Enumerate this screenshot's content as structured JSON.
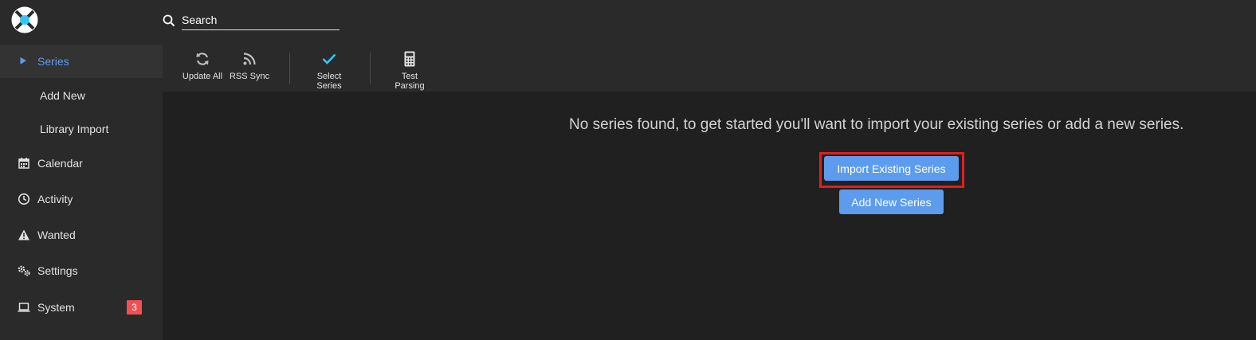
{
  "header": {
    "logo_icon": "sonarr-logo-icon",
    "search": {
      "placeholder": "Search",
      "value": ""
    }
  },
  "sidebar": {
    "items": [
      {
        "label": "Series",
        "icon": "play-icon",
        "active": true
      },
      {
        "label": "Add New",
        "sub": true
      },
      {
        "label": "Library Import",
        "sub": true
      },
      {
        "label": "Calendar",
        "icon": "calendar-icon"
      },
      {
        "label": "Activity",
        "icon": "clock-icon"
      },
      {
        "label": "Wanted",
        "icon": "warning-icon"
      },
      {
        "label": "Settings",
        "icon": "gears-icon"
      },
      {
        "label": "System",
        "icon": "laptop-icon",
        "badge": "3"
      }
    ]
  },
  "toolbar": {
    "update_all": "Update All",
    "rss_sync": "RSS Sync",
    "select_series_line1": "Select",
    "select_series_line2": "Series",
    "test_parsing_line1": "Test",
    "test_parsing_line2": "Parsing"
  },
  "main": {
    "empty_message": "No series found, to get started you'll want to import your existing series or add a new series.",
    "import_button": "Import Existing Series",
    "add_button": "Add New Series"
  },
  "colors": {
    "accent": "#5d9cec",
    "badge": "#f05050",
    "highlight": "#e31e1e",
    "background": "#202020",
    "panel": "#2a2a2a"
  }
}
